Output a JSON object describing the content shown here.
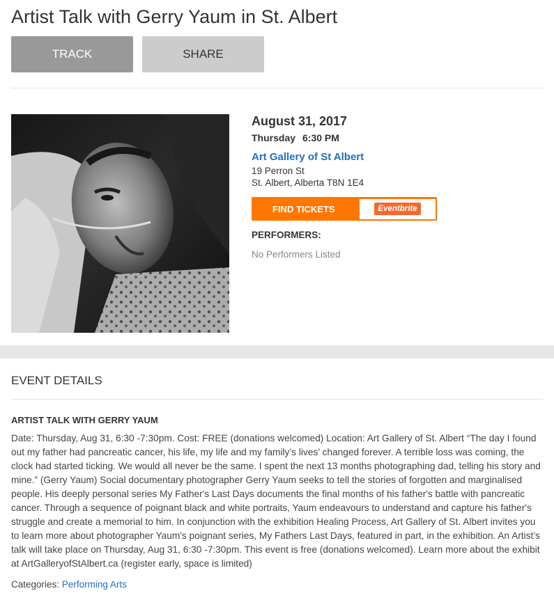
{
  "event": {
    "title": "Artist Talk with Gerry Yaum in St. Albert",
    "buttons": {
      "track": "TRACK",
      "share": "SHARE"
    },
    "date": "August 31, 2017",
    "weekday": "Thursday",
    "time": "6:30 PM",
    "venue": {
      "name": "Art Gallery of St Albert",
      "street": "19 Perron St",
      "city_line": "St. Albert, Alberta T8N 1E4"
    },
    "tickets": {
      "label": "FIND TICKETS",
      "provider": "Eventbrite"
    },
    "performers": {
      "heading": "PERFORMERS:",
      "none_text": "No Performers Listed"
    }
  },
  "details": {
    "heading": "EVENT DETAILS",
    "subheading": "ARTIST TALK WITH GERRY YAUM",
    "description": "Date: Thursday, Aug 31, 6:30 -7:30pm. Cost: FREE (donations welcomed) Location: Art Gallery of St. Albert “The day I found out my father had pancreatic cancer, his life, my life and my family’s lives’ changed forever. A terrible loss was coming, the clock had started ticking. We would all never be the same. I spent the next 13 months photographing dad, telling his story and mine.” (Gerry Yaum) Social documentary photographer Gerry Yaum seeks to tell the stories of forgotten and marginalised people. His deeply personal series My Father's Last Days documents the final months of his father's battle with pancreatic cancer. Through a sequence of poignant black and white portraits, Yaum endeavours to understand and capture his father's struggle and create a memorial to him. In conjunction with the exhibition Healing Process, Art Gallery of St. Albert invites you to learn more about photographer Yaum's poignant series, My Fathers Last Days, featured in part, in the exhibition.  An Artist’s talk will take place on Thursday, Aug 31, 6:30 -7:30pm. This event is free (donations welcomed). Learn more about the exhibit at ArtGalleryofStAlbert.ca (register early, space is limited)",
    "categories_label": "Categories:",
    "category": "Performing Arts"
  }
}
